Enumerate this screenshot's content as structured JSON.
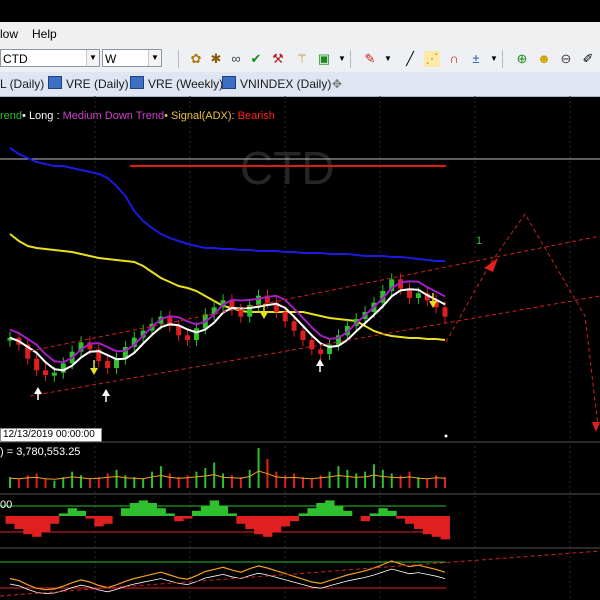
{
  "menu": {
    "items": [
      "low",
      "Help"
    ]
  },
  "toolbar": {
    "symbol_value": "CTD",
    "period_value": "W"
  },
  "tabs": [
    {
      "label": "L (Daily)"
    },
    {
      "label": "VRE (Daily)"
    },
    {
      "label": "VRE (Weekly)"
    },
    {
      "label": "VNINDEX (Daily)"
    }
  ],
  "chart": {
    "watermark": "CTD",
    "status": {
      "part1": "rend",
      "sep1": "• Long : ",
      "long_value": "Medium Down Trend",
      "sep2": "• Signal(ADX): ",
      "signal_value": "Bearish"
    },
    "wave_label": "1",
    "date_box": "12/13/2019 00:00:00",
    "volume_label": ") = 3,780,553.25",
    "indicator_label": "00"
  },
  "colors": {
    "bull": "#2fbf2f",
    "bear": "#e02020",
    "upper_band": "#1a1ae0",
    "lower_band": "#e8e020",
    "ma": "#ffffff",
    "purple": "#a020c0",
    "resistance": "#e01818"
  },
  "chart_data": {
    "type": "candlestick",
    "series": [
      {
        "name": "price",
        "values": [
          18.5,
          18.2,
          17.6,
          17.1,
          16.9,
          17.0,
          17.4,
          17.9,
          18.3,
          18.0,
          17.5,
          17.2,
          17.6,
          18.1,
          18.5,
          18.8,
          19.1,
          19.4,
          19.0,
          18.6,
          18.4,
          18.9,
          19.5,
          19.8,
          20.1,
          19.7,
          19.4,
          19.9,
          20.3,
          20.0,
          19.6,
          19.2,
          18.8,
          18.4,
          18.0,
          17.8,
          18.2,
          18.6,
          19.0,
          19.3,
          19.6,
          20.0,
          20.5,
          21.0,
          20.6,
          20.2,
          20.4,
          20.1,
          19.8,
          19.4
        ]
      }
    ],
    "volume": [
      0.6,
      0.5,
      0.7,
      0.8,
      0.5,
      0.4,
      0.6,
      0.9,
      0.7,
      0.5,
      0.6,
      0.8,
      1.0,
      0.7,
      0.6,
      0.5,
      0.9,
      1.2,
      0.8,
      0.6,
      0.7,
      0.9,
      1.1,
      1.4,
      0.8,
      0.7,
      0.6,
      1.0,
      2.2,
      1.6,
      0.9,
      0.7,
      0.8,
      0.6,
      0.5,
      0.7,
      0.9,
      1.2,
      1.0,
      0.8,
      0.9,
      1.3,
      1.0,
      0.8,
      0.7,
      0.9,
      0.6,
      0.5,
      0.7,
      0.6
    ],
    "oscillator": [
      -0.3,
      -0.5,
      -0.7,
      -0.8,
      -0.6,
      -0.3,
      0.1,
      0.3,
      0.2,
      -0.1,
      -0.4,
      -0.3,
      0.0,
      0.3,
      0.5,
      0.6,
      0.5,
      0.3,
      0.1,
      -0.2,
      -0.1,
      0.2,
      0.4,
      0.6,
      0.4,
      0.1,
      -0.3,
      -0.5,
      -0.7,
      -0.8,
      -0.6,
      -0.4,
      -0.2,
      0.1,
      0.3,
      0.5,
      0.6,
      0.4,
      0.2,
      0.0,
      -0.2,
      0.1,
      0.3,
      0.2,
      -0.1,
      -0.3,
      -0.5,
      -0.7,
      -0.8,
      -0.9
    ]
  }
}
